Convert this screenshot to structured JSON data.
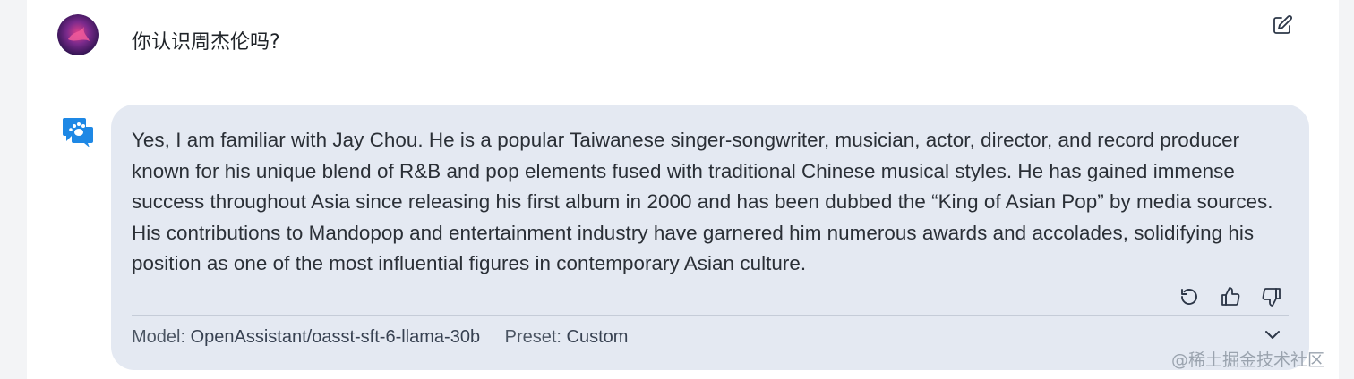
{
  "user_message": {
    "text": "你认识周杰伦吗?"
  },
  "assistant_message": {
    "text": "Yes, I am familiar with Jay Chou. He is a popular Taiwanese singer-songwriter, musician, actor, director, and record producer known for his unique blend of R&B and pop elements fused with traditional Chinese musical styles. He has gained immense success throughout Asia since releasing his first album in 2000 and has been dubbed the “King of Asian Pop” by media sources. His contributions to Mandopop and entertainment industry have garnered him numerous awards and accolades, solidifying his position as one of the most influential figures in contemporary Asian culture.",
    "meta": {
      "model_label": "Model:",
      "model_value": "OpenAssistant/oasst-sft-6-llama-30b",
      "preset_label": "Preset:",
      "preset_value": "Custom"
    }
  },
  "icons": {
    "edit": "edit-icon",
    "regenerate": "refresh-icon",
    "like": "thumbs-up-icon",
    "dislike": "thumbs-down-icon",
    "expand": "chevron-down-icon",
    "bot": "chat-bubbles-icon"
  },
  "watermark": "@稀土掘金技术社区",
  "colors": {
    "bubble": "#e4e9f2",
    "bot_icon": "#1e88e5",
    "avatar_bg": "#3b1c6e"
  }
}
